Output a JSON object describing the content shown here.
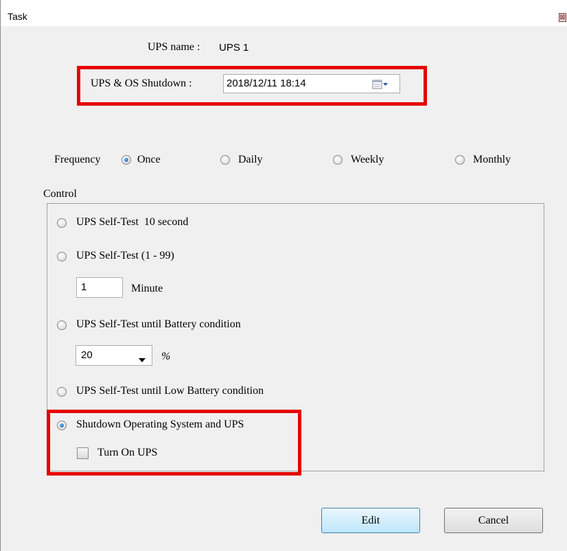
{
  "window": {
    "title": "Task",
    "close_glyph": "⊠"
  },
  "ups_name": {
    "label": "UPS name :",
    "value": "UPS 1"
  },
  "shutdown": {
    "label": "UPS & OS Shutdown :",
    "datetime": "2018/12/11 18:14",
    "picker_icon": "calendar-icon"
  },
  "frequency": {
    "label": "Frequency",
    "options": [
      "Once",
      "Daily",
      "Weekly",
      "Monthly"
    ],
    "selected": "Once"
  },
  "control": {
    "label": "Control",
    "option_self_test_10s": "UPS Self-Test  10 second",
    "option_self_test_range": "UPS Self-Test (1 - 99)",
    "minutes_value": "1",
    "minutes_unit": "Minute",
    "option_until_battery": "UPS Self-Test until Battery condition",
    "battery_percent_value": "20",
    "battery_percent_unit": "%",
    "option_until_low_battery": "UPS Self-Test until Low Battery condition",
    "option_shutdown_os_ups": "Shutdown Operating System and UPS",
    "turn_on_ups_label": "Turn On UPS",
    "turn_on_ups_checked": false,
    "selected": "Shutdown Operating System and UPS"
  },
  "buttons": {
    "edit": "Edit",
    "cancel": "Cancel"
  },
  "colors": {
    "highlight": "#e60000",
    "radio_selected": "#1f6ac8",
    "dialog_bg": "#f0f0f0"
  }
}
